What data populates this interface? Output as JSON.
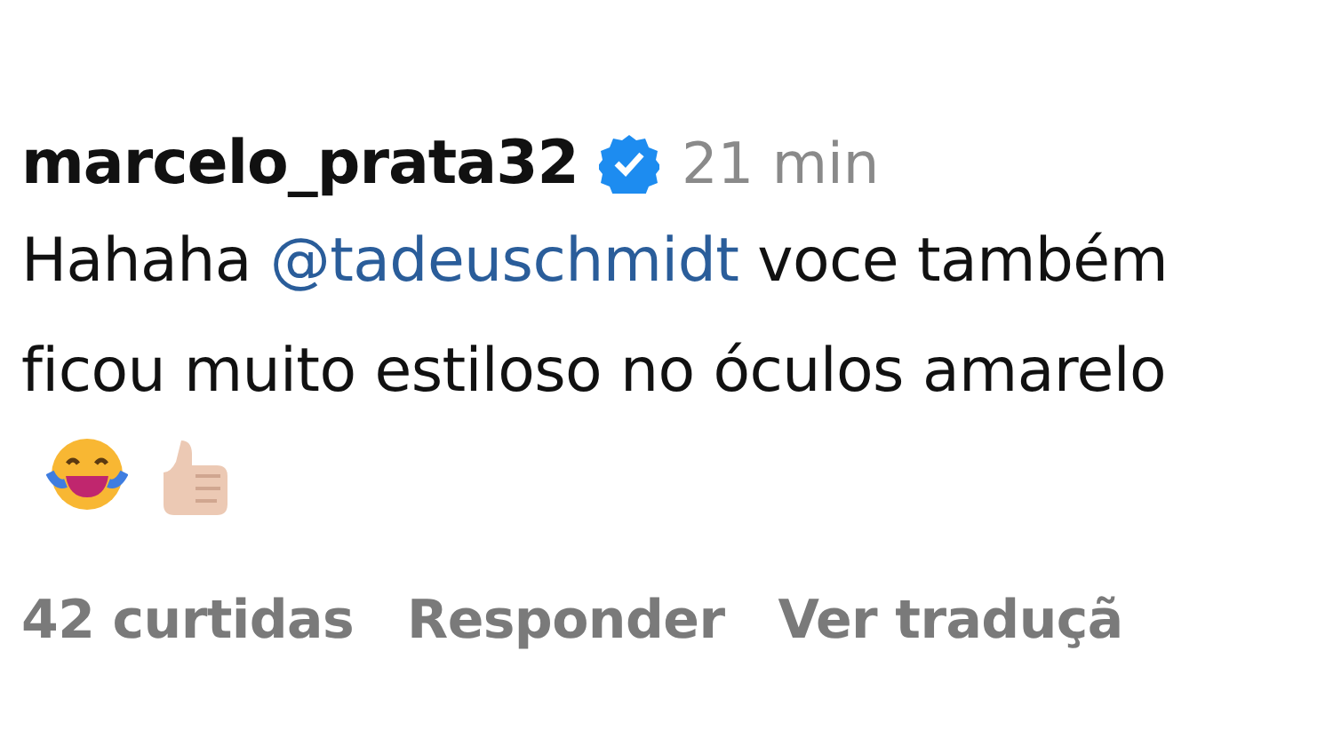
{
  "comment": {
    "username": "marcelo_prata32",
    "verified": true,
    "time": "21 min",
    "text_before": "Hahaha ",
    "mention": "@tadeuschmidt",
    "text_after": " voce também ficou muito estiloso no óculos amarelo",
    "actions": [
      "42 curtidas",
      "Responder",
      "Ver traduçã"
    ]
  }
}
